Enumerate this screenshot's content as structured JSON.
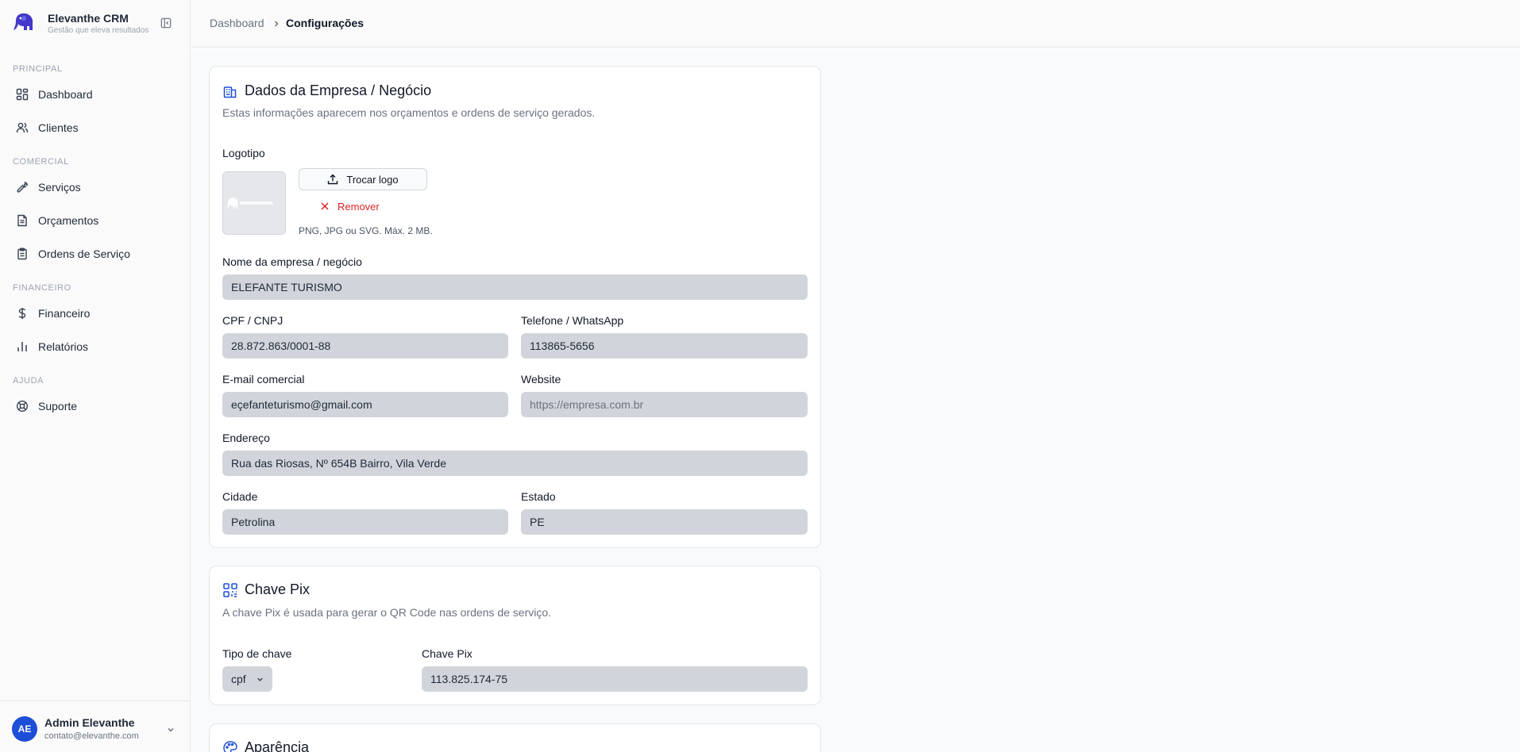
{
  "brand": {
    "name": "Elevanthe CRM",
    "tagline": "Gestão que eleva resultados"
  },
  "sidebar": {
    "sections": [
      {
        "label": "PRINCIPAL"
      },
      {
        "label": "COMERCIAL"
      },
      {
        "label": "FINANCEIRO"
      },
      {
        "label": "AJUDA"
      }
    ],
    "items": [
      {
        "label": "Dashboard",
        "icon": "dashboard-grid-icon"
      },
      {
        "label": "Clientes",
        "icon": "users-icon"
      },
      {
        "label": "Serviços",
        "icon": "wrench-icon"
      },
      {
        "label": "Orçamentos",
        "icon": "document-icon"
      },
      {
        "label": "Ordens de Serviço",
        "icon": "clipboard-icon"
      },
      {
        "label": "Financeiro",
        "icon": "dollar-icon"
      },
      {
        "label": "Relatórios",
        "icon": "bar-chart-icon"
      },
      {
        "label": "Suporte",
        "icon": "lifebuoy-icon"
      }
    ]
  },
  "user": {
    "initials": "AE",
    "name": "Admin Elevanthe",
    "email": "contato@elevanthe.com"
  },
  "header": {
    "breadcrumb_home": "Dashboard",
    "breadcrumb_current": "Configurações"
  },
  "company_card": {
    "title": "Dados da Empresa / Negócio",
    "description": "Estas informações aparecem nos orçamentos e ordens de serviço gerados.",
    "logo_label": "Logotipo",
    "change_logo": "Trocar logo",
    "remove_logo": "Remover",
    "logo_hint": "PNG, JPG ou SVG. Máx. 2 MB.",
    "fields": {
      "name": {
        "label": "Nome da empresa / negócio",
        "value": "ELEFANTE TURISMO"
      },
      "document": {
        "label": "CPF / CNPJ",
        "value": "28.872.863/0001-88"
      },
      "phone": {
        "label": "Telefone / WhatsApp",
        "value": "113865-5656"
      },
      "email": {
        "label": "E-mail comercial",
        "value": "eçefanteturismo@gmail.com"
      },
      "website": {
        "label": "Website",
        "value": "",
        "placeholder": "https://empresa.com.br"
      },
      "address": {
        "label": "Endereço",
        "value": "Rua das Riosas, Nº 654B Bairro, Vila Verde"
      },
      "city": {
        "label": "Cidade",
        "value": "Petrolina"
      },
      "state": {
        "label": "Estado",
        "value": "PE"
      }
    }
  },
  "pix_card": {
    "title": "Chave Pix",
    "description": "A chave Pix é usada para gerar o QR Code nas ordens de serviço.",
    "key_type_label": "Tipo de chave",
    "key_type_value": "cpf",
    "key_label": "Chave Pix",
    "key_value": "113.825.174-75"
  },
  "appearance_card": {
    "title": "Aparência"
  },
  "colors": {
    "accent": "#1d4ed8",
    "danger": "#dc2626",
    "input_bg": "#d1d5db"
  }
}
